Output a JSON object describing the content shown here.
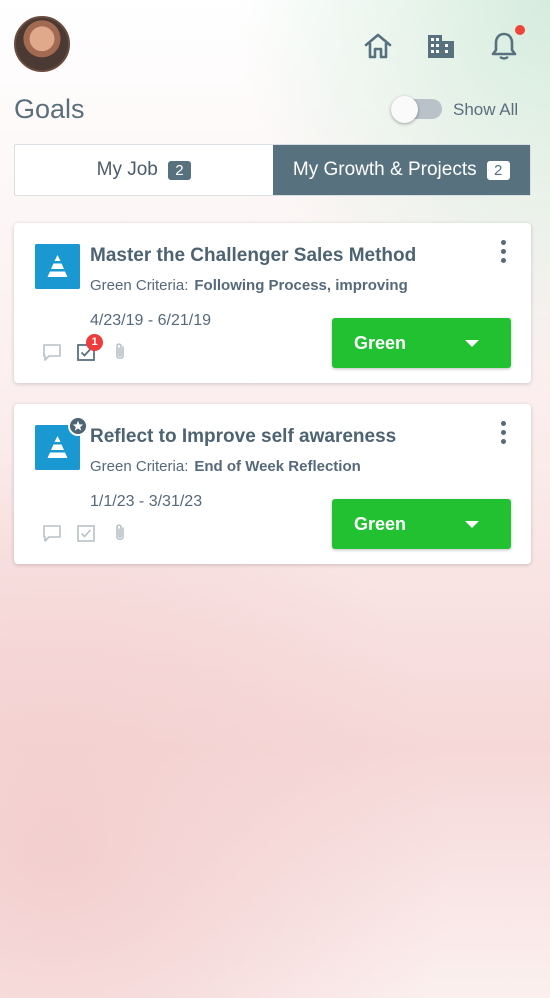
{
  "header": {
    "icons": [
      "home-icon",
      "building-icon",
      "bell-icon"
    ],
    "has_notification": true
  },
  "page": {
    "title": "Goals",
    "show_all_label": "Show All",
    "show_all_on": false
  },
  "tabs": [
    {
      "label": "My Job",
      "count": "2",
      "active": false
    },
    {
      "label": "My Growth & Projects",
      "count": "2",
      "active": true
    }
  ],
  "goals": [
    {
      "title": "Master the Challenger Sales Method",
      "criteria_label": "Green Criteria:",
      "criteria_value": "Following Process, improving",
      "dates": "4/23/19 - 6/21/19",
      "task_badge": "1",
      "status": "Green",
      "starred": false
    },
    {
      "title": "Reflect to Improve self awareness",
      "criteria_label": "Green Criteria:",
      "criteria_value": "End of Week Reflection",
      "dates": "1/1/23 - 3/31/23",
      "status": "Green",
      "starred": true
    }
  ],
  "colors": {
    "accent": "#57717f",
    "goal_icon": "#1a98d1",
    "status_green": "#22c132",
    "notification": "#f0433a"
  }
}
